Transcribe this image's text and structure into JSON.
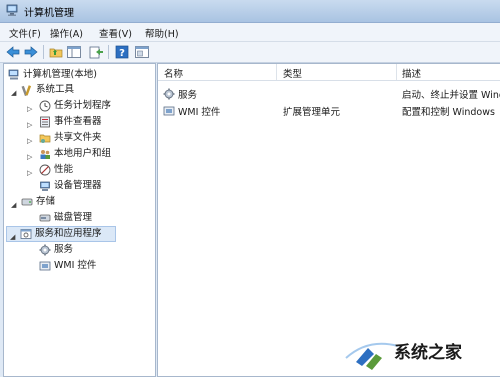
{
  "window": {
    "title": "计算机管理"
  },
  "menu": {
    "file": "文件(F)",
    "action": "操作(A)",
    "view": "查看(V)",
    "help": "帮助(H)"
  },
  "tree": {
    "root": "计算机管理(本地)",
    "system_tools": "系统工具",
    "task_scheduler": "任务计划程序",
    "event_viewer": "事件查看器",
    "shared_folders": "共享文件夹",
    "local_users": "本地用户和组",
    "performance": "性能",
    "device_manager": "设备管理器",
    "storage": "存储",
    "disk_management": "磁盘管理",
    "services_apps": "服务和应用程序",
    "services": "服务",
    "wmi": "WMI 控件"
  },
  "list": {
    "columns": {
      "name": "名称",
      "type": "类型",
      "desc": "描述"
    },
    "rows": [
      {
        "name": "服务",
        "type": "",
        "desc": "启动、终止并设置 Wind"
      },
      {
        "name": "WMI 控件",
        "type": "扩展管理单元",
        "desc": "配置和控制 Windows"
      }
    ]
  },
  "watermark": {
    "text": "系统之家"
  }
}
